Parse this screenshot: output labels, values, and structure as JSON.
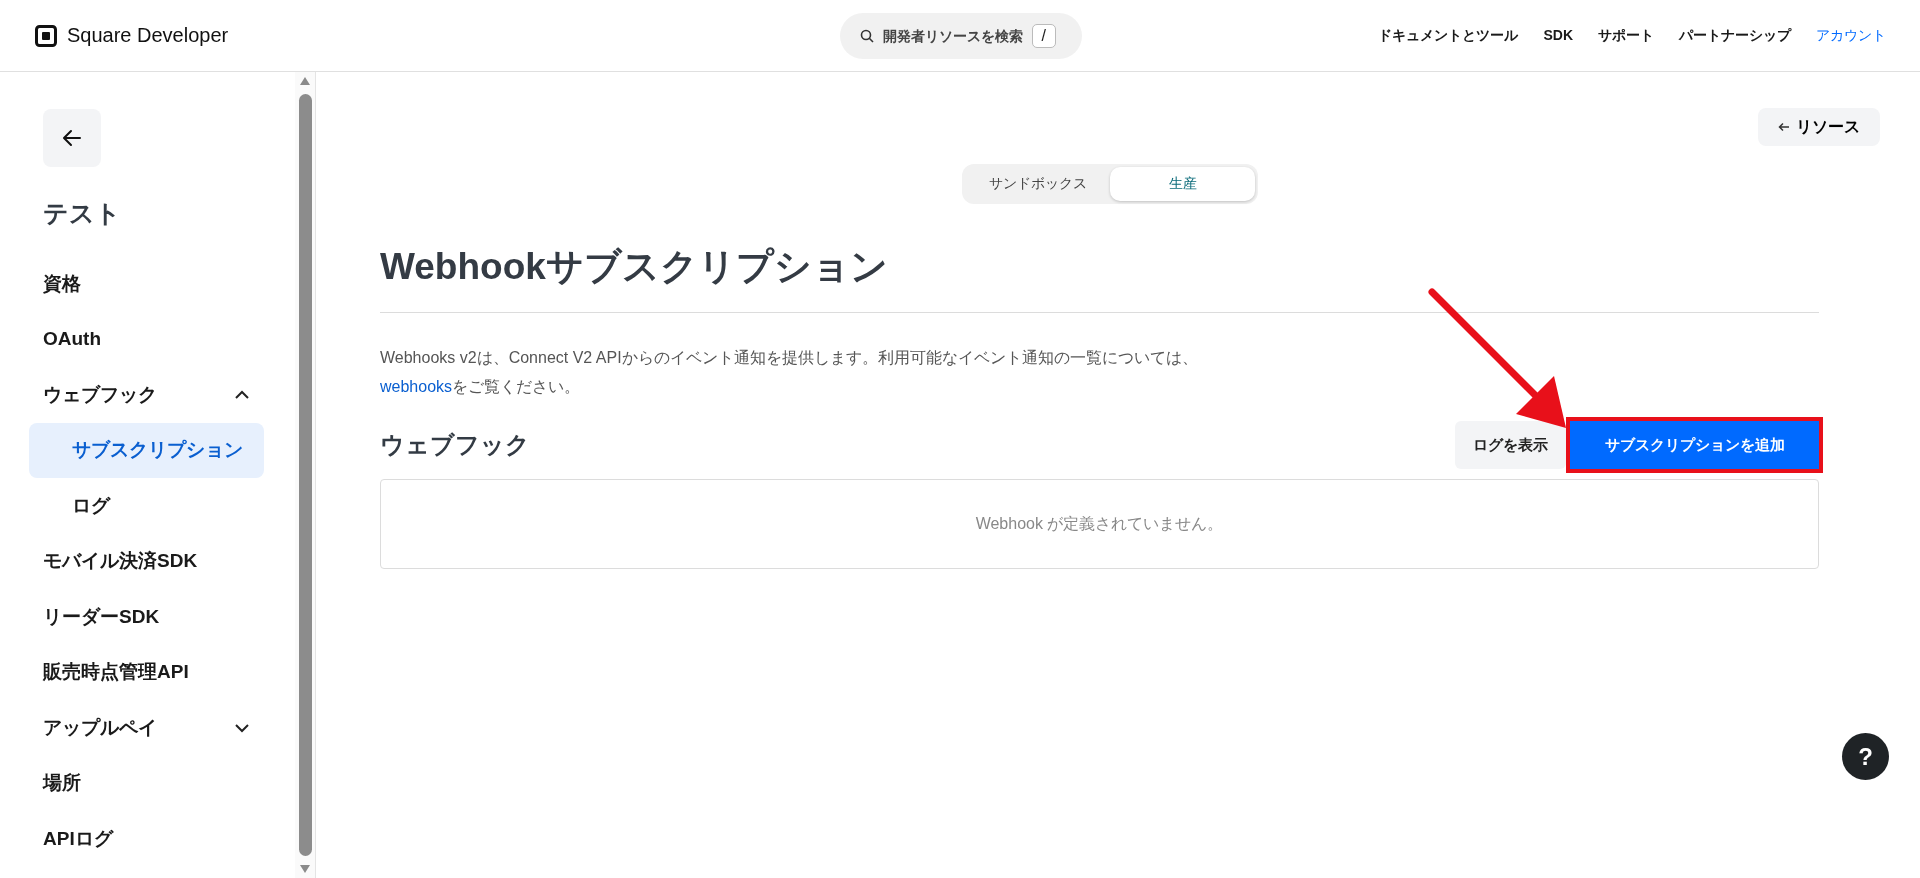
{
  "header": {
    "logo": "Square Developer",
    "search": {
      "placeholder": "開発者リソースを検索",
      "shortcut": "/"
    },
    "nav": [
      {
        "label": "ドキュメントとツール",
        "selected": false
      },
      {
        "label": "SDK",
        "selected": false
      },
      {
        "label": "サポート",
        "selected": false
      },
      {
        "label": "パートナーシップ",
        "selected": false
      },
      {
        "label": "アカウント",
        "selected": true
      }
    ]
  },
  "sidebar": {
    "title": "テスト",
    "items": [
      {
        "label": "資格",
        "selected": false
      },
      {
        "label": "OAuth",
        "selected": false
      },
      {
        "label": "ウェブフック",
        "selected": false,
        "expanded": true,
        "children": [
          {
            "label": "サブスクリプション",
            "selected": true
          },
          {
            "label": "ログ",
            "selected": false
          }
        ]
      },
      {
        "label": "モバイル決済SDK",
        "selected": false
      },
      {
        "label": "リーダーSDK",
        "selected": false
      },
      {
        "label": "販売時点管理API",
        "selected": false
      },
      {
        "label": "アップルペイ",
        "selected": false,
        "expanded": false
      },
      {
        "label": "場所",
        "selected": false
      },
      {
        "label": "APIログ",
        "selected": false
      }
    ]
  },
  "main": {
    "resources_button": "リソース",
    "environment_tabs": [
      {
        "label": "サンドボックス",
        "selected": false
      },
      {
        "label": "生産",
        "selected": true
      }
    ],
    "title": "Webhookサブスクリプション",
    "description": {
      "before": "Webhooks v2は、Connect V2 APIからのイベント通知を提供します。利用可能なイベント通知の一覧については、 ",
      "link": "webhooks",
      "after": "をご覧ください。"
    },
    "section_title": "ウェブフック",
    "buttons": [
      {
        "label": "ログを表示",
        "kind": "secondary",
        "highlighted": false
      },
      {
        "label": "サブスクリプションを追加",
        "kind": "primary",
        "highlighted": true
      }
    ],
    "empty_message": "Webhook が定義されていません。"
  },
  "help_button": "?"
}
